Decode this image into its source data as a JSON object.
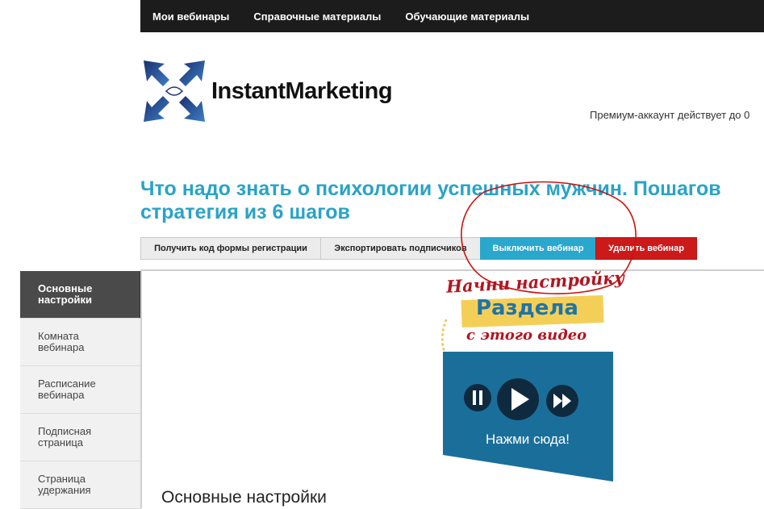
{
  "topnav": {
    "items": [
      "Мои вебинары",
      "Справочные материалы",
      "Обучающие материалы"
    ]
  },
  "logo": {
    "brand": "InstantMarketing"
  },
  "premium": {
    "text": "Премиум-аккаунт действует до 0"
  },
  "webinar": {
    "title_line1": "Что надо знать о психологии успешных мужчин. Пошагов",
    "title_line2": "стратегия из 6 шагов"
  },
  "actions": {
    "get_code": "Получить код формы регистрации",
    "export": "Экспортировать подписчиков",
    "disable": "Выключить вебинар",
    "delete": "Удалить вебинар"
  },
  "sidebar": {
    "items": [
      {
        "label": "Основные настройки"
      },
      {
        "label": "Комната вебинара"
      },
      {
        "label": "Расписание вебинара"
      },
      {
        "label": "Подписная страница"
      },
      {
        "label": "Страница удержания"
      }
    ]
  },
  "content": {
    "heading": "Основные настройки"
  },
  "overlay": {
    "line1": "Начни настройку",
    "line2": "Раздела",
    "line3": "с этого видео",
    "video_caption": "Нажми сюда!"
  },
  "colors": {
    "title": "#29a3c7",
    "blue_button": "#2aa7cc",
    "red_button": "#cc1a1a",
    "annotation_red": "#b01620",
    "video_bg": "#1a6f9a"
  }
}
